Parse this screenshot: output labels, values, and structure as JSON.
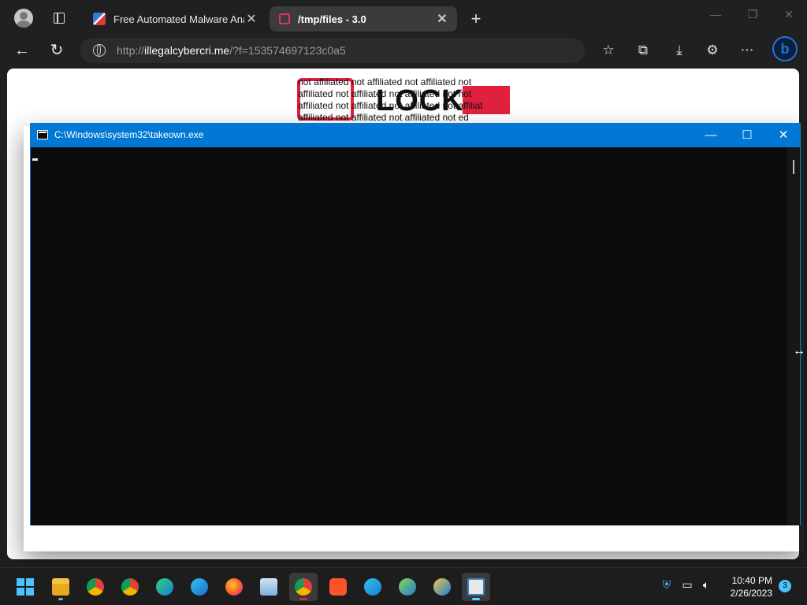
{
  "browser": {
    "tabs": [
      {
        "title": "Free Automated Malware Analy",
        "active": false
      },
      {
        "title": "/tmp/files - 3.0",
        "active": true
      }
    ],
    "new_tab": "+",
    "address": {
      "scheme": "http://",
      "host": "illegalcybercri.me",
      "path": "/?f=153574697123c0a5"
    },
    "window_controls": {
      "minimize": "—",
      "restore": "❐",
      "close": "✕"
    }
  },
  "page": {
    "logo_text": "LOCK",
    "overlay_lines": [
      "not affiliated not affiliated not affiliated not",
      "affiliated not affiliated not affiliated not not",
      "affiliated not affiliated not affiliated not affiliat",
      "affiliated not affiliated not affiliated not ed"
    ]
  },
  "console": {
    "title": "C:\\Windows\\system32\\takeown.exe",
    "controls": {
      "minimize": "—",
      "maximize": "☐",
      "close": "✕"
    }
  },
  "taskbar": {
    "apps": [
      "start",
      "file-explorer",
      "chrome",
      "chrome-canary",
      "edge",
      "edge-profile",
      "firefox",
      "resource-monitor",
      "chrome-active",
      "brave",
      "edge-beta",
      "edge-dev",
      "edge-canary",
      "console-app"
    ],
    "clock": {
      "time": "10:40 PM",
      "date": "2/26/2023"
    },
    "notification_count": "3"
  }
}
